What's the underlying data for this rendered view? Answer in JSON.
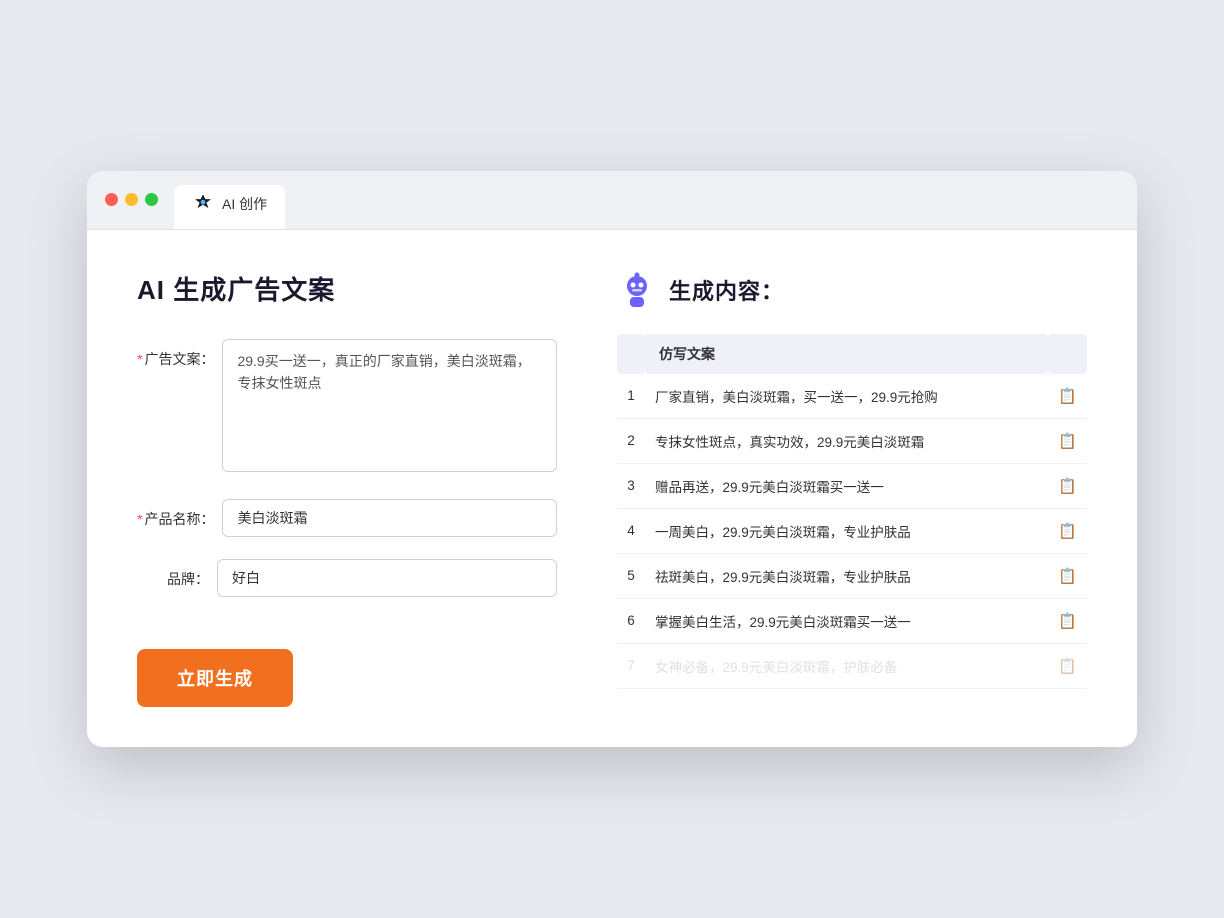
{
  "browser": {
    "tab_label": "AI 创作"
  },
  "left_panel": {
    "title": "AI 生成广告文案",
    "form": {
      "ad_copy_label": "广告文案：",
      "ad_copy_required": "*",
      "ad_copy_value": "29.9买一送一，真正的厂家直销，美白淡斑霜，专抹女性斑点",
      "product_name_label": "产品名称：",
      "product_name_required": "*",
      "product_name_value": "美白淡斑霜",
      "brand_label": "品牌：",
      "brand_value": "好白"
    },
    "generate_button": "立即生成"
  },
  "right_panel": {
    "title": "生成内容：",
    "table": {
      "header": "仿写文案",
      "rows": [
        {
          "num": 1,
          "text": "厂家直销，美白淡斑霜，买一送一，29.9元抢购"
        },
        {
          "num": 2,
          "text": "专抹女性斑点，真实功效，29.9元美白淡斑霜"
        },
        {
          "num": 3,
          "text": "赠品再送，29.9元美白淡斑霜买一送一"
        },
        {
          "num": 4,
          "text": "一周美白，29.9元美白淡斑霜，专业护肤品"
        },
        {
          "num": 5,
          "text": "祛斑美白，29.9元美白淡斑霜，专业护肤品"
        },
        {
          "num": 6,
          "text": "掌握美白生活，29.9元美白淡斑霜买一送一"
        },
        {
          "num": 7,
          "text": "女神必备，29.9元美白淡斑霜，护肤必备",
          "faded": true
        }
      ]
    }
  }
}
